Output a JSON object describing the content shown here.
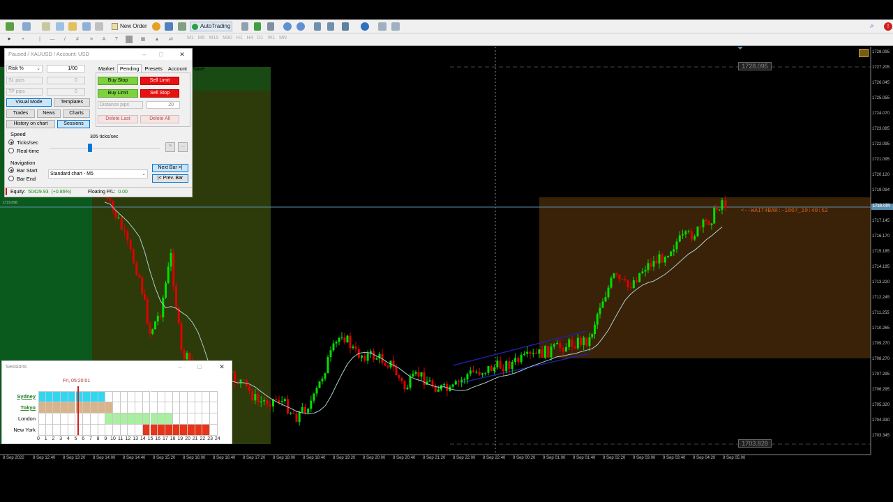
{
  "toolbar": {
    "new_order_label": "New Order",
    "autotrading_label": "AutoTrading",
    "timeframes": [
      "M1",
      "M5",
      "M15",
      "M30",
      "H1",
      "H4",
      "D1",
      "W1",
      "MN"
    ]
  },
  "panel": {
    "title": "Paused / XAUUSD / Account: USD",
    "risk_mode": "Risk %",
    "risk_value": "1/00",
    "sl_label": "SL pips",
    "sl_value": "0",
    "tp_label": "TP pips",
    "tp_value": "0",
    "tabs": [
      "Market",
      "Pending",
      "Presets",
      "Account",
      "Save"
    ],
    "active_tab": "Pending",
    "buy_stop": "Buy Stop",
    "sell_limit": "Sell Limit",
    "buy_limit": "Buy Limit",
    "sell_stop": "Sell Stop",
    "distance_label": "Distance pips",
    "distance_value": "20",
    "delete_last": "Delete Last",
    "delete_all": "Delete All",
    "visual_mode": "Visual Mode",
    "templates": "Templates",
    "trades": "Trades",
    "news": "News",
    "charts": "Charts",
    "history_on_chart": "History on chart",
    "sessions": "Sessions",
    "speed_label": "Speed",
    "speed_value": "305 ticks/sec",
    "ticks_sec": "Ticks/sec",
    "realtime": "Real-time",
    "play_button": ">",
    "more_button": "...",
    "navigation_label": "Navigation",
    "bar_start": "Bar Start",
    "bar_end": "Bar End",
    "chart_select": "Standard chart - M5",
    "next_bar": "Next Bar >|",
    "prev_bar": "|< Prev. Bar",
    "equity_label": "Equity:",
    "equity_value": "50429.93",
    "equity_change": "(+0.86%)",
    "floating_label": "Floating P/L:",
    "floating_value": "0.00"
  },
  "sessions": {
    "title": "Sessions",
    "current_time": "Fri, 05:20:01",
    "names": [
      "Sydney",
      "Tokyo",
      "London",
      "New York"
    ],
    "hours": [
      "0",
      "1",
      "2",
      "3",
      "4",
      "5",
      "6",
      "7",
      "8",
      "9",
      "10",
      "11",
      "12",
      "13",
      "14",
      "15",
      "16",
      "17",
      "18",
      "19",
      "20",
      "21",
      "22",
      "23",
      "24"
    ],
    "colors": {
      "sydney": "#33d6f0",
      "tokyo": "#d9b48a",
      "london": "#a8f0a0",
      "newyork": "#e83418"
    }
  },
  "chart": {
    "price_labels": [
      "1728.095",
      "1727.205",
      "1726.045",
      "1725.055",
      "1724.070",
      "1723.085",
      "1722.095",
      "1721.095",
      "1720.120",
      "1719.094",
      "1718.135",
      "1717.145",
      "1716.170",
      "1715.185",
      "1714.195",
      "1713.220",
      "1712.245",
      "1711.255",
      "1710.265",
      "1709.270",
      "1708.270",
      "1707.295",
      "1706.295",
      "1705.320",
      "1704.330",
      "1703.345"
    ],
    "time_labels": [
      "8 Sep 2022",
      "8 Sep 12:40",
      "8 Sep 13:20",
      "8 Sep 14:00",
      "8 Sep 14:40",
      "8 Sep 15:20",
      "8 Sep 16:00",
      "8 Sep 16:40",
      "8 Sep 17:20",
      "8 Sep 18:00",
      "8 Sep 18:40",
      "8 Sep 19:20",
      "8 Sep 20:00",
      "8 Sep 20:40",
      "8 Sep 21:20",
      "8 Sep 22:00",
      "8 Sep 22:40",
      "9 Sep 00:20",
      "9 Sep 01:00",
      "9 Sep 01:40",
      "9 Sep 02:20",
      "9 Sep 03:00",
      "9 Sep 03:40",
      "9 Sep 04:20",
      "9 Sep 05:00"
    ],
    "high_marker": "1728.095",
    "low_marker": "1703.828",
    "bid_label": "1719.094",
    "left_bid_label": "1719.098",
    "annotation": "<--WAIT4BAR:-1007_10:40:52",
    "bull_color": "#00e000",
    "bear_color": "#e00000"
  }
}
